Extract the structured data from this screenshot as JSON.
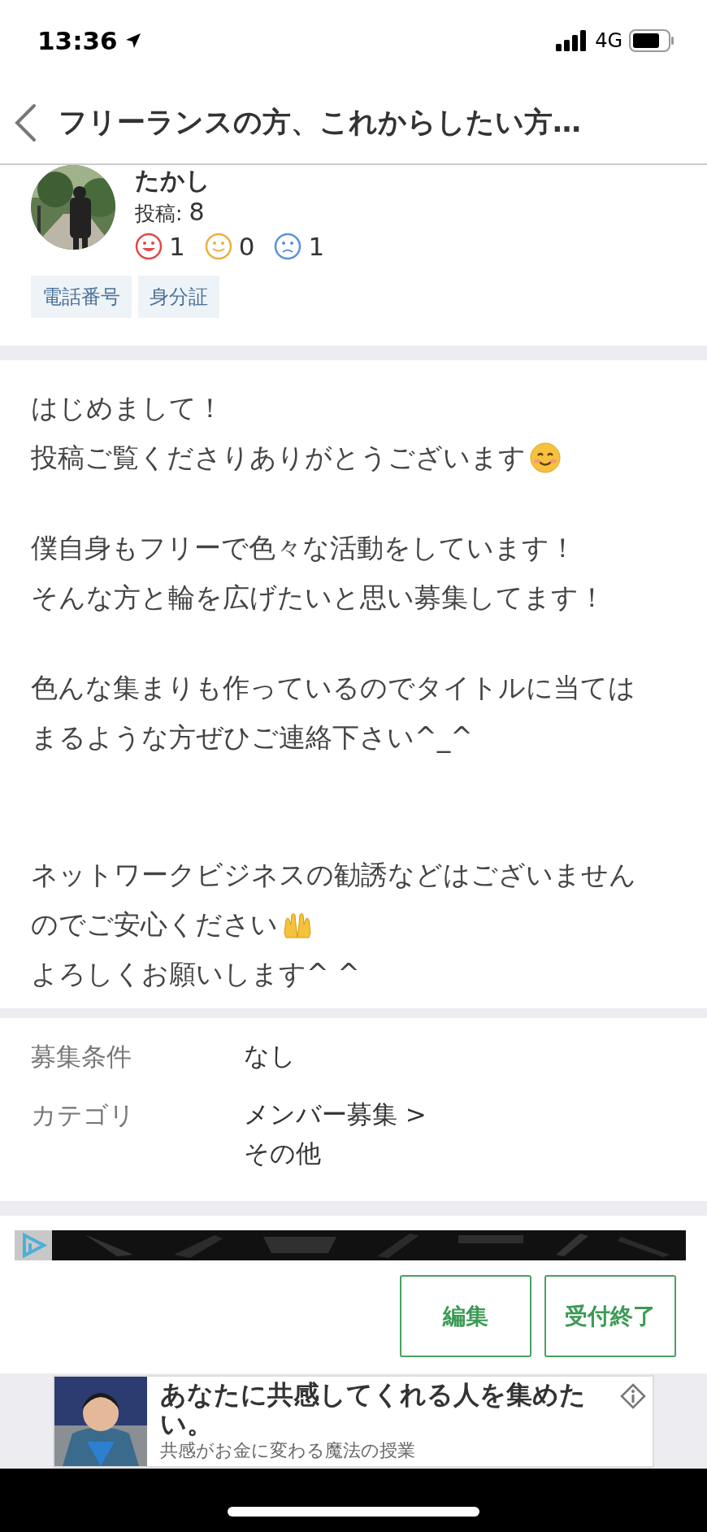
{
  "status_bar": {
    "time": "13:36",
    "network": "4G"
  },
  "nav": {
    "title": "フリーランスの方、これからしたい方…"
  },
  "profile": {
    "name": "たかし",
    "posts_label": "投稿:",
    "posts": "8",
    "ratings": [
      {
        "kind": "good",
        "count": "1"
      },
      {
        "kind": "neutral",
        "count": "0"
      },
      {
        "kind": "bad",
        "count": "1"
      }
    ],
    "badges": [
      "電話番号",
      "身分証"
    ]
  },
  "body": {
    "paragraphs": [
      {
        "lines": [
          {
            "kind": "plain",
            "text": "はじめまして！"
          },
          {
            "kind": "smile",
            "text": "投稿ご覧くださりありがとうございます"
          }
        ]
      },
      {
        "lines": [
          {
            "kind": "plain",
            "text": "僕自身もフリーで色々な活動をしています！"
          },
          {
            "kind": "plain",
            "text": "そんな方と輪を広げたいと思い募集してます！"
          }
        ]
      },
      {
        "lines": [
          {
            "kind": "plain",
            "text": "色んな集まりも作っているのでタイトルに当ては"
          },
          {
            "kind": "plain",
            "text": "まるような方ぜひご連絡下さい^_^"
          }
        ]
      },
      {
        "lines": [
          {
            "kind": "plain",
            "text": "ネットワークビジネスの勧誘などはございません"
          },
          {
            "kind": "hands",
            "text": "のでご安心ください"
          },
          {
            "kind": "plain",
            "text": "よろしくお願いします^ ^"
          }
        ]
      }
    ]
  },
  "conditions": [
    {
      "label": "募集条件",
      "values": [
        "なし"
      ]
    },
    {
      "label": "カテゴリ",
      "values": [
        "メンバー募集 >",
        "その他"
      ]
    }
  ],
  "actions": [
    {
      "label": "編集"
    },
    {
      "label": "受付終了"
    }
  ],
  "ad": {
    "title": "あなたに共感してくれる人を集めたい。",
    "subtitle": "共感がお金に変わる魔法の授業"
  }
}
